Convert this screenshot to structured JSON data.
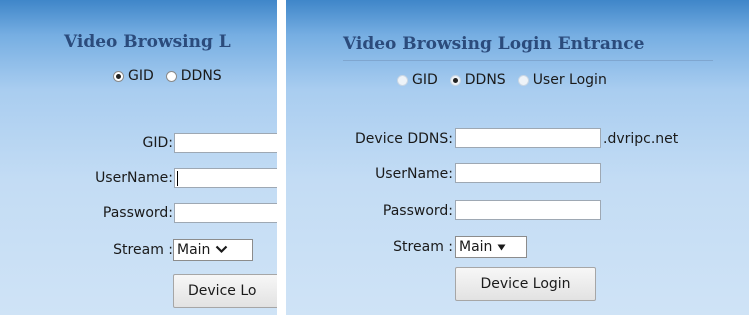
{
  "left": {
    "title": "Video Browsing L",
    "radios": [
      {
        "label": "GID",
        "selected": true
      },
      {
        "label": "DDNS",
        "selected": false
      }
    ],
    "gid_label": "GID:",
    "username_label": "UserName:",
    "password_label": "Password:",
    "stream_label": "Stream :",
    "stream_value": "Main",
    "button_label": "Device Lo"
  },
  "right": {
    "title": "Video Browsing Login Entrance",
    "radios": [
      {
        "label": "GID",
        "selected": false
      },
      {
        "label": "DDNS",
        "selected": true
      },
      {
        "label": "User Login",
        "selected": false
      }
    ],
    "ddns_label": "Device DDNS:",
    "ddns_suffix": ".dvripc.net",
    "username_label": "UserName:",
    "password_label": "Password:",
    "stream_label": "Stream :",
    "stream_value": "Main",
    "button_label": "Device Login"
  },
  "icons": {
    "left_select_chevron": "chevron-down-icon",
    "right_select_arrow": "triangle-down-icon"
  }
}
